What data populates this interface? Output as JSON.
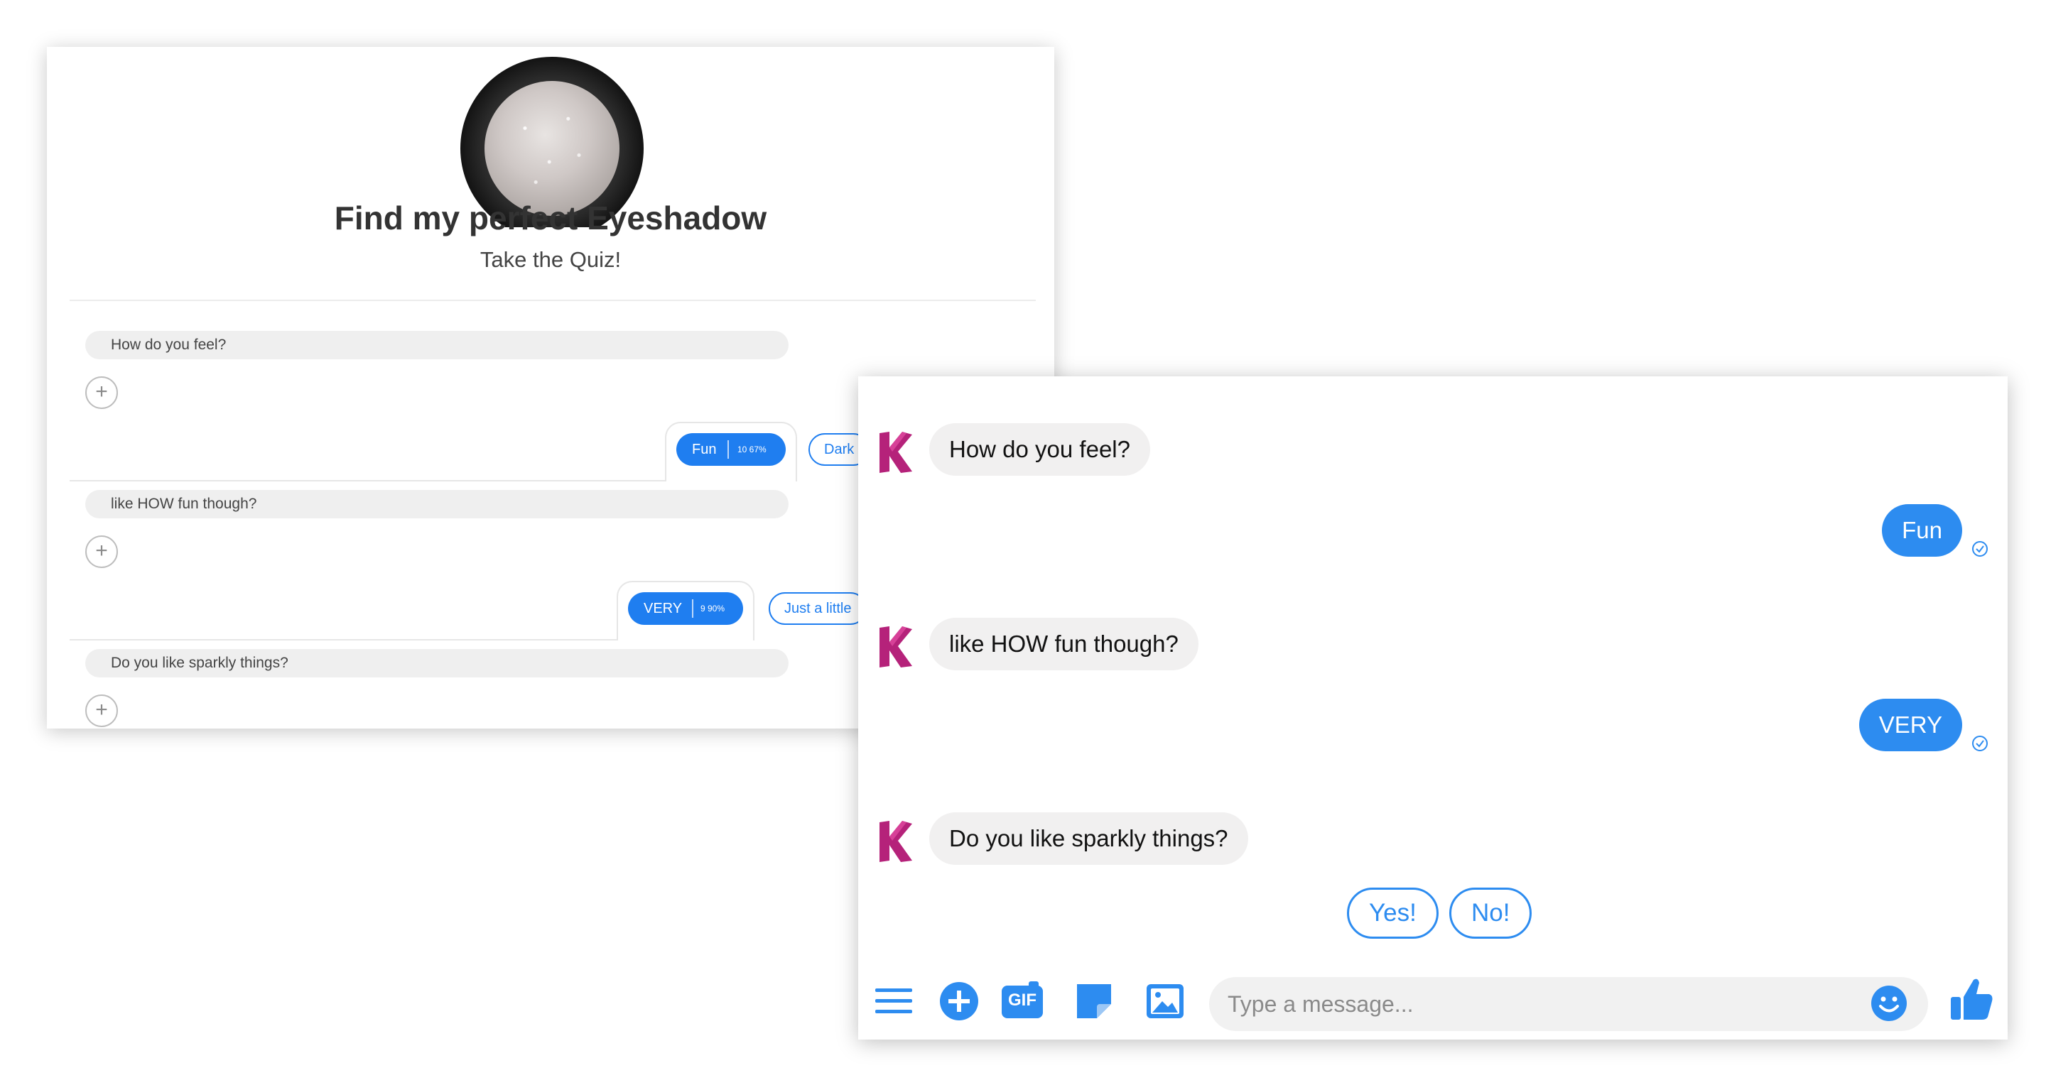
{
  "quiz": {
    "title": "Find my perfect Eyeshadow",
    "subtitle": "Take the Quiz!",
    "questions": [
      {
        "text": "How do you feel?",
        "selected": {
          "label": "Fun",
          "stat": "10 67%"
        },
        "other": "Dark"
      },
      {
        "text": "like HOW fun though?",
        "selected": {
          "label": "VERY",
          "stat": "9 90%"
        },
        "other": "Just a little"
      },
      {
        "text": "Do you like sparkly things?"
      }
    ]
  },
  "chat": {
    "messages": [
      {
        "from": "bot",
        "text": "How do you feel?"
      },
      {
        "from": "user",
        "text": "Fun"
      },
      {
        "from": "bot",
        "text": "like HOW fun though?"
      },
      {
        "from": "user",
        "text": "VERY"
      },
      {
        "from": "bot",
        "text": "Do you like sparkly things?"
      }
    ],
    "quick_replies": [
      "Yes!",
      "No!"
    ],
    "input_placeholder": "Type a message...",
    "gif_label": "GIF",
    "colors": {
      "accent": "#2d8cf0",
      "brand": "#b5227a"
    }
  }
}
